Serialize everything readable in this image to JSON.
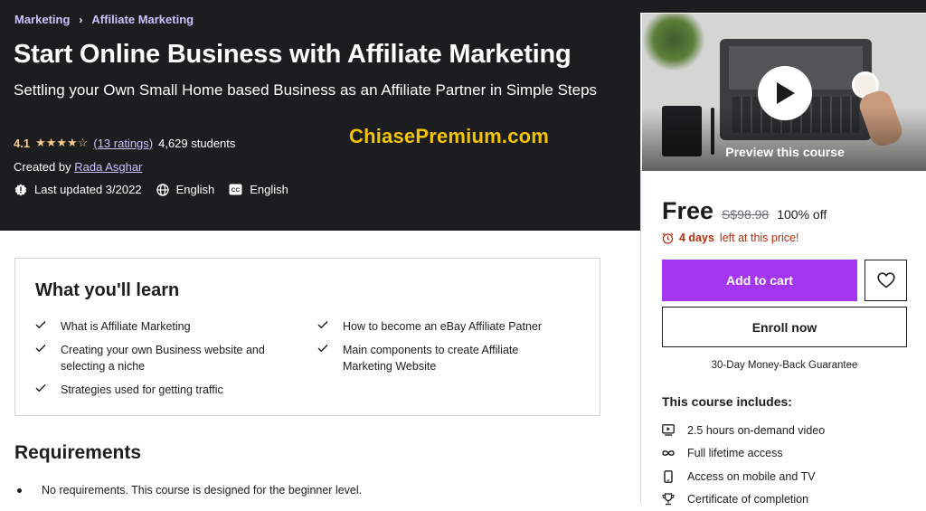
{
  "breadcrumb": {
    "items": [
      "Marketing",
      "Affiliate Marketing"
    ],
    "separator": "›"
  },
  "course": {
    "title": "Start Online Business with Affiliate Marketing",
    "subtitle": "Settling your Own Small Home based Business as an Affiliate Partner in Simple Steps",
    "rating_value": "4.1",
    "stars": "★★★★☆",
    "rating_count": "(13 ratings)",
    "students": "4,629 students",
    "created_by_label": "Created by",
    "instructor": "Rada Asghar",
    "last_updated": "Last updated 3/2022",
    "language": "English",
    "captions": "English"
  },
  "watermark": "ChiasePremium.com",
  "preview": {
    "label": "Preview this course"
  },
  "pricing": {
    "price": "Free",
    "original_price": "S$98.98",
    "discount": "100% off",
    "timer_bold": "4 days",
    "timer_rest": "left at this price!",
    "add_to_cart": "Add to cart",
    "enroll": "Enroll now",
    "guarantee": "30-Day Money-Back Guarantee"
  },
  "includes": {
    "title": "This course includes:",
    "items": [
      {
        "icon": "video-icon",
        "label": "2.5 hours on-demand video"
      },
      {
        "icon": "infinity-icon",
        "label": "Full lifetime access"
      },
      {
        "icon": "mobile-icon",
        "label": "Access on mobile and TV"
      },
      {
        "icon": "trophy-icon",
        "label": "Certificate of completion"
      }
    ]
  },
  "learn": {
    "title": "What you'll learn",
    "left": [
      "What is Affiliate Marketing",
      "Creating your own Business website and selecting a niche",
      "Strategies used for getting traffic"
    ],
    "right": [
      "How to become an eBay Affiliate Patner",
      "Main components to create Affiliate Marketing Website"
    ]
  },
  "requirements": {
    "title": "Requirements",
    "items": [
      "No requirements. This course is designed for the beginner level."
    ]
  },
  "colors": {
    "hero_bg": "#1c1d1f",
    "accent_purple": "#a435f0",
    "link_purple": "#cec0fc",
    "star": "#f3ca8c",
    "alert_red": "#b32d0f",
    "watermark": "#f5c400"
  }
}
